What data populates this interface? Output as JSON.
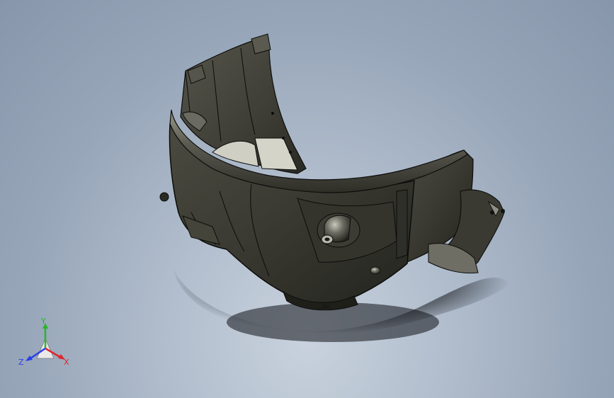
{
  "viewport": {
    "name": "3d-graphics-viewport",
    "model_name": "shell-part-3d-model"
  },
  "triad": {
    "axes": [
      {
        "label": "Y",
        "color": "#2bb52b"
      },
      {
        "label": "X",
        "color": "#e0262b"
      },
      {
        "label": "Z",
        "color": "#2a3ee8"
      }
    ]
  },
  "colors": {
    "background_center": "#c9d2de",
    "background_edge": "#8796aa",
    "model_body": "#3a3a32",
    "model_highlight": "#8a8a80",
    "model_edges": "#0c0c0a",
    "inner_light": "#d9d9cf"
  }
}
